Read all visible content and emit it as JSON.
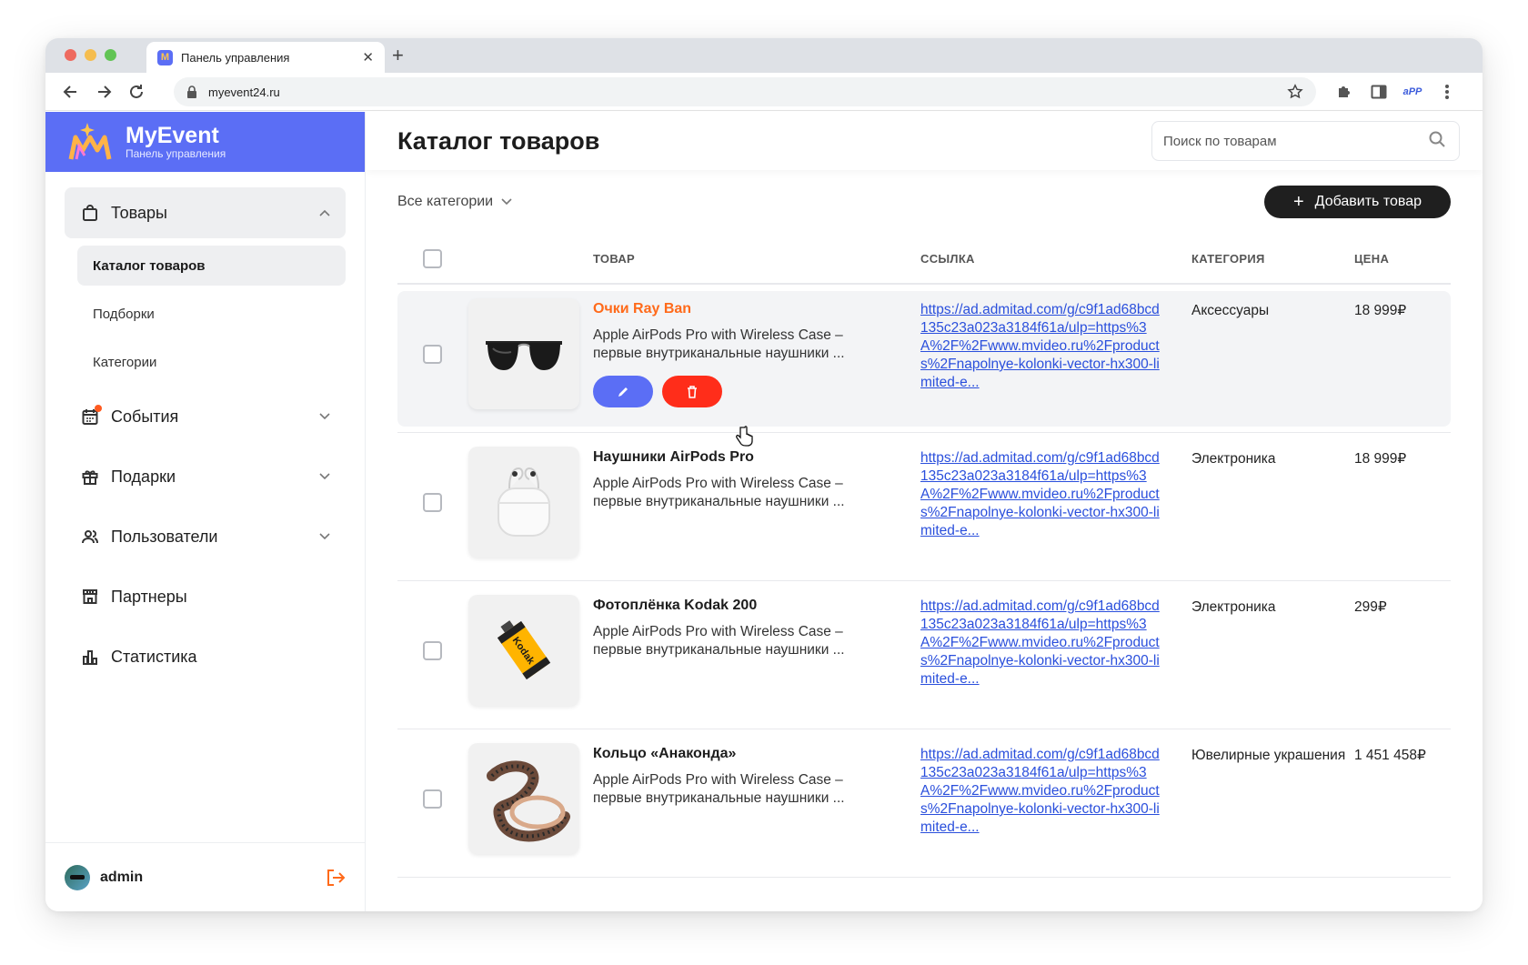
{
  "browser": {
    "tab_title": "Панель управления",
    "url": "myevent24.ru"
  },
  "brand": {
    "name": "MyEvent",
    "subtitle": "Панель управления"
  },
  "sidebar": {
    "items": [
      {
        "label": "Товары",
        "icon": "shopping-bag-icon",
        "expanded": true
      },
      {
        "label": "События",
        "icon": "calendar-icon",
        "has_notification": true
      },
      {
        "label": "Подарки",
        "icon": "gift-icon"
      },
      {
        "label": "Пользователи",
        "icon": "users-icon"
      },
      {
        "label": "Партнеры",
        "icon": "store-icon"
      },
      {
        "label": "Статистика",
        "icon": "chart-icon"
      }
    ],
    "subitems": [
      "Каталог товаров",
      "Подборки",
      "Категории"
    ],
    "user": "admin"
  },
  "page": {
    "title": "Каталог товаров",
    "search_placeholder": "Поиск по товарам",
    "filter_label": "Все категории",
    "add_button": "Добавить товар"
  },
  "table": {
    "headers": [
      "ТОВАР",
      "ССЫЛКА",
      "КАТЕГОРИЯ",
      "ЦЕНА"
    ],
    "rows": [
      {
        "name": "Очки Ray Ban",
        "description": "Apple AirPods Pro with Wireless Case – первые внутриканальные наушники ...",
        "link": "https://ad.admitad.com/g/c9f1ad68bcd135c23a023a3184f61a/ulp=https%3A%2F%2Fwww.mvideo.ru%2Fproducts%2Fnapolnye-kolonki-vector-hx300-limited-e...",
        "category": "Аксессуары",
        "price": "18 999₽"
      },
      {
        "name": "Наушники AirPods Pro",
        "description": "Apple AirPods Pro with Wireless Case – первые внутриканальные наушники ...",
        "link": "https://ad.admitad.com/g/c9f1ad68bcd135c23a023a3184f61a/ulp=https%3A%2F%2Fwww.mvideo.ru%2Fproducts%2Fnapolnye-kolonki-vector-hx300-limited-e...",
        "category": "Электроника",
        "price": "18 999₽"
      },
      {
        "name": "Фотоплёнка Kodak 200",
        "description": "Apple AirPods Pro with Wireless Case – первые внутриканальные наушники ...",
        "link": "https://ad.admitad.com/g/c9f1ad68bcd135c23a023a3184f61a/ulp=https%3A%2F%2Fwww.mvideo.ru%2Fproducts%2Fnapolnye-kolonki-vector-hx300-limited-e...",
        "category": "Электроника",
        "price": "299₽"
      },
      {
        "name": "Кольцо «Анаконда»",
        "description": "Apple AirPods Pro with Wireless Case – первые внутриканальные наушники ...",
        "link": "https://ad.admitad.com/g/c9f1ad68bcd135c23a023a3184f61a/ulp=https%3A%2F%2Fwww.mvideo.ru%2Fproducts%2Fnapolnye-kolonki-vector-hx300-limited-e...",
        "category": "Ювелирные украшения",
        "price": "1 451 458₽"
      }
    ]
  },
  "colors": {
    "brand": "#5b6ef5",
    "highlight": "#ff6a1a",
    "danger": "#ff2d1a",
    "link": "#2a4fdc"
  }
}
